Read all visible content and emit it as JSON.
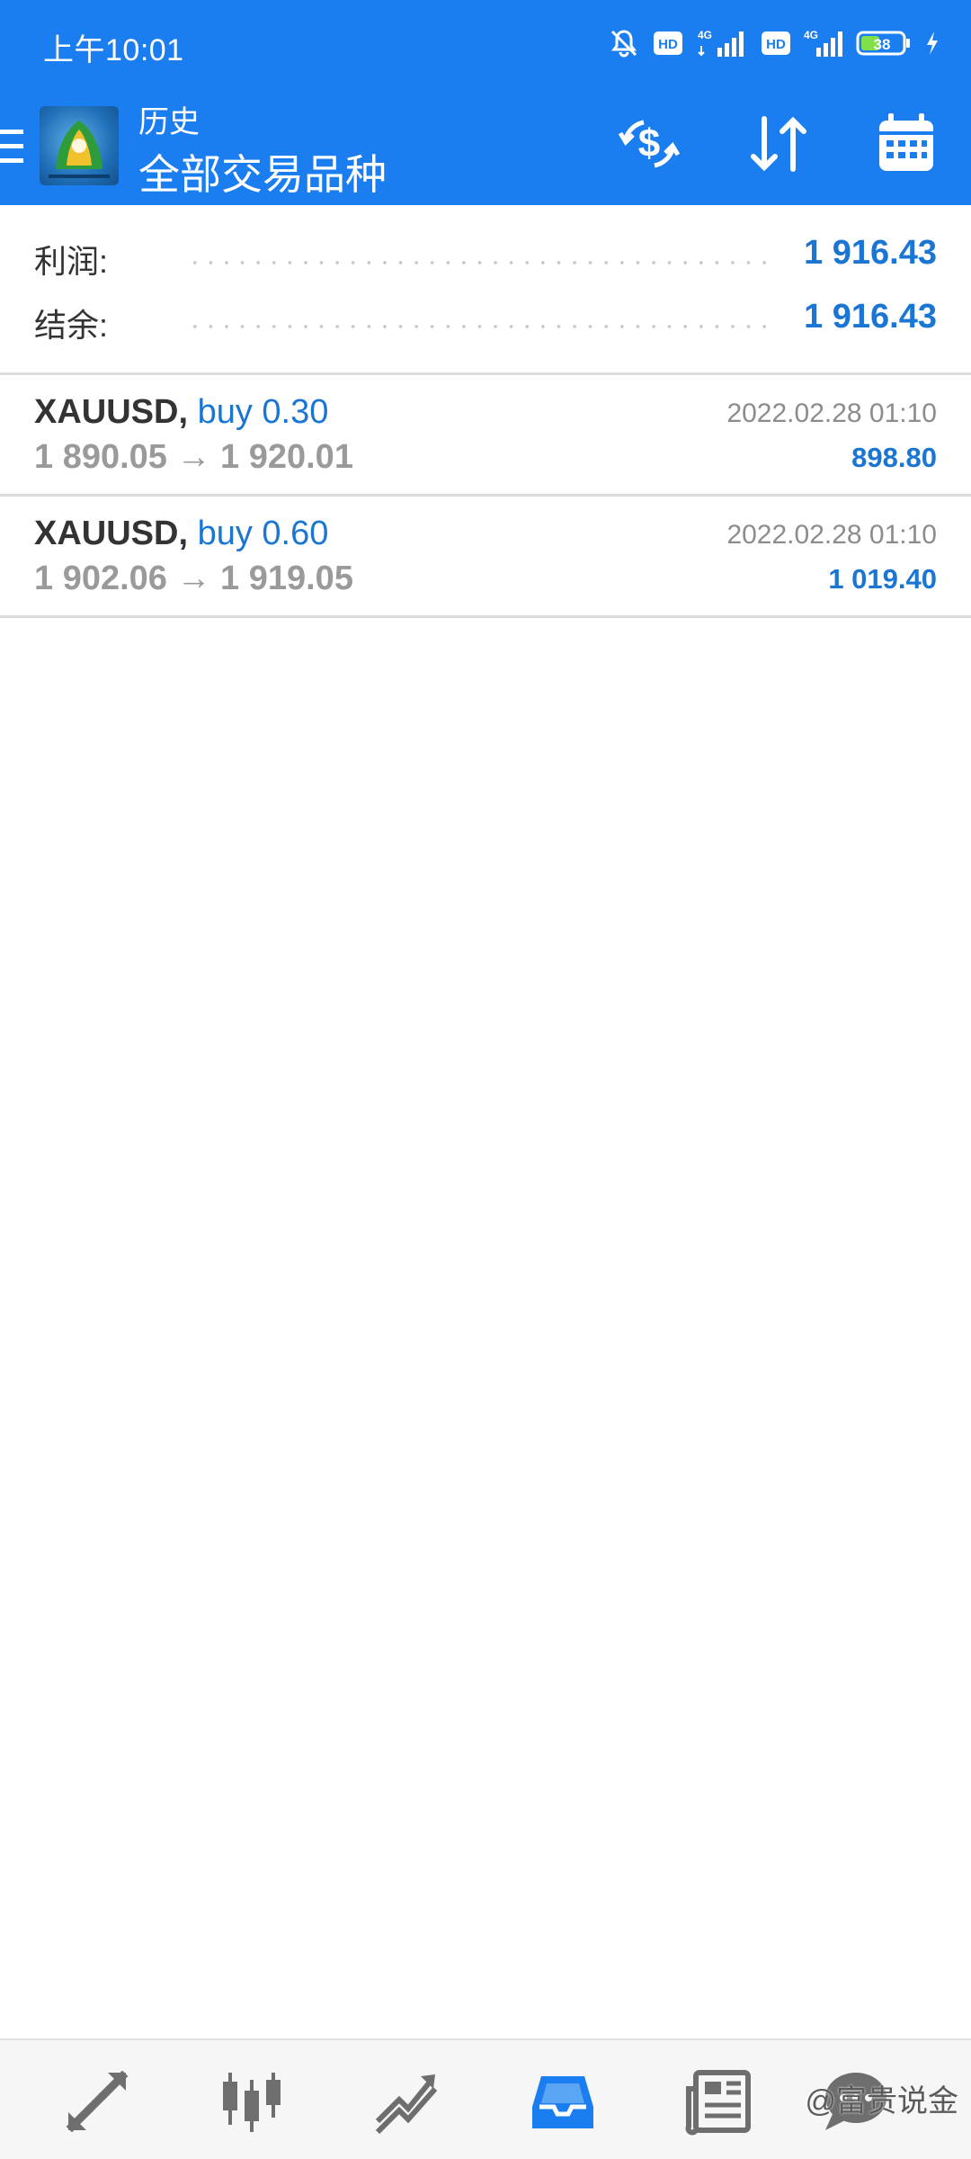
{
  "status_bar": {
    "time": "上午10:01",
    "battery": "38",
    "network_1": "4G",
    "network_2": "4G",
    "hd_1": "HD",
    "hd_2": "HD"
  },
  "header": {
    "subtitle": "历史",
    "title": "全部交易品种",
    "icons": [
      "menu-icon",
      "app-logo-icon",
      "currency-exchange-icon",
      "sort-icon",
      "calendar-icon"
    ]
  },
  "summary": {
    "profit_label": "利润:",
    "profit_value": "1 916.43",
    "balance_label": "结余:",
    "balance_value": "1 916.43"
  },
  "deals": [
    {
      "symbol": "XAUUSD",
      "separator": ",",
      "type": "buy 0.30",
      "prices": "1 890.05 → 1 920.01",
      "time": "2022.02.28 01:10",
      "profit": "898.80"
    },
    {
      "symbol": "XAUUSD",
      "separator": ",",
      "type": "buy 0.60",
      "prices": "1 902.06 → 1 919.05",
      "time": "2022.02.28 01:10",
      "profit": "1 019.40"
    }
  ],
  "bottom_nav": {
    "items": [
      "quotes-icon",
      "chart-icon",
      "trade-icon",
      "history-icon",
      "news-icon",
      "chat-icon"
    ],
    "active": "history-icon",
    "watermark": "@富贵说金"
  },
  "colors": {
    "header_bg": "#1a7df0",
    "accent_blue": "#1a76d2",
    "muted_gray": "#9a9a9a",
    "active_nav": "#1a7df0",
    "inactive_nav": "#6e6e6e"
  }
}
